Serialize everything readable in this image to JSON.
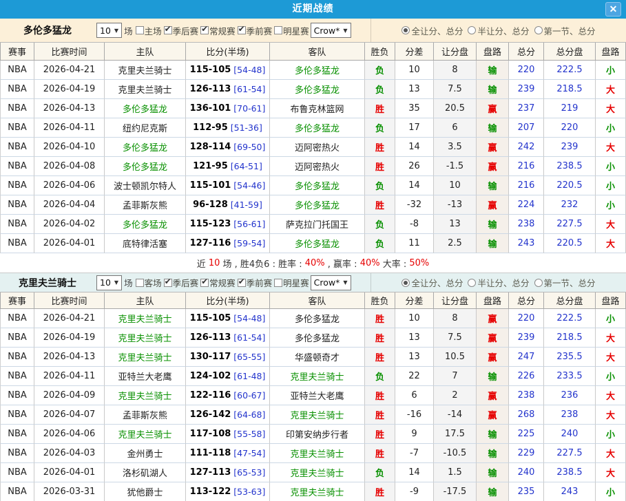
{
  "header": {
    "title": "近期战绩",
    "close_label": "✕"
  },
  "colors": {
    "header_blue": "#1d9ad6",
    "close_btn_blue": "#4da6e2",
    "filter1_bg": "#fcf0d9",
    "filter2_bg": "#e4f1f1",
    "win_red": "#e60000",
    "lose_green": "#089000",
    "number_blue": "#2233cc",
    "team_green": "#089000"
  },
  "sections": [
    {
      "filter": {
        "team": "多伦多猛龙",
        "count_value": "10",
        "count_suffix": "场",
        "checkboxes": [
          {
            "label": "主场",
            "checked": false
          },
          {
            "label": "季后赛",
            "checked": true
          },
          {
            "label": "常规赛",
            "checked": true
          },
          {
            "label": "季前赛",
            "checked": true
          },
          {
            "label": "明星赛",
            "checked": false
          }
        ],
        "team_select_value": "Crow*",
        "radios": [
          {
            "label": "全让分、总分",
            "selected": true
          },
          {
            "label": "半让分、总分",
            "selected": false
          },
          {
            "label": "第一节、总分",
            "selected": false
          }
        ]
      },
      "columns": [
        "赛事",
        "比赛时间",
        "主队",
        "比分(半场)",
        "客队",
        "胜负",
        "分差",
        "让分盘",
        "盘路",
        "总分",
        "总分盘",
        "盘路"
      ],
      "rows": [
        {
          "league": "NBA",
          "date": "2026-04-21",
          "home": "克里夫兰骑士",
          "home_focus": false,
          "score": "115-105",
          "half": "[54-48]",
          "away": "多伦多猛龙",
          "away_focus": true,
          "result": "负",
          "diff": "10",
          "handicap": "8",
          "handicap_result": "输",
          "total": "220",
          "total_line": "222.5",
          "total_result": "小"
        },
        {
          "league": "NBA",
          "date": "2026-04-19",
          "home": "克里夫兰骑士",
          "home_focus": false,
          "score": "126-113",
          "half": "[61-54]",
          "away": "多伦多猛龙",
          "away_focus": true,
          "result": "负",
          "diff": "13",
          "handicap": "7.5",
          "handicap_result": "输",
          "total": "239",
          "total_line": "218.5",
          "total_result": "大"
        },
        {
          "league": "NBA",
          "date": "2026-04-13",
          "home": "多伦多猛龙",
          "home_focus": true,
          "score": "136-101",
          "half": "[70-61]",
          "away": "布鲁克林篮网",
          "away_focus": false,
          "result": "胜",
          "diff": "35",
          "handicap": "20.5",
          "handicap_result": "赢",
          "total": "237",
          "total_line": "219",
          "total_result": "大"
        },
        {
          "league": "NBA",
          "date": "2026-04-11",
          "home": "纽约尼克斯",
          "home_focus": false,
          "score": "112-95",
          "half": "[51-36]",
          "away": "多伦多猛龙",
          "away_focus": true,
          "result": "负",
          "diff": "17",
          "handicap": "6",
          "handicap_result": "输",
          "total": "207",
          "total_line": "220",
          "total_result": "小"
        },
        {
          "league": "NBA",
          "date": "2026-04-10",
          "home": "多伦多猛龙",
          "home_focus": true,
          "score": "128-114",
          "half": "[69-50]",
          "away": "迈阿密热火",
          "away_focus": false,
          "result": "胜",
          "diff": "14",
          "handicap": "3.5",
          "handicap_result": "赢",
          "total": "242",
          "total_line": "239",
          "total_result": "大"
        },
        {
          "league": "NBA",
          "date": "2026-04-08",
          "home": "多伦多猛龙",
          "home_focus": true,
          "score": "121-95",
          "half": "[64-51]",
          "away": "迈阿密热火",
          "away_focus": false,
          "result": "胜",
          "diff": "26",
          "handicap": "-1.5",
          "handicap_result": "赢",
          "total": "216",
          "total_line": "238.5",
          "total_result": "小"
        },
        {
          "league": "NBA",
          "date": "2026-04-06",
          "home": "波士顿凯尔特人",
          "home_focus": false,
          "score": "115-101",
          "half": "[54-46]",
          "away": "多伦多猛龙",
          "away_focus": true,
          "result": "负",
          "diff": "14",
          "handicap": "10",
          "handicap_result": "输",
          "total": "216",
          "total_line": "220.5",
          "total_result": "小"
        },
        {
          "league": "NBA",
          "date": "2026-04-04",
          "home": "孟菲斯灰熊",
          "home_focus": false,
          "score": "96-128",
          "half": "[41-59]",
          "away": "多伦多猛龙",
          "away_focus": true,
          "result": "胜",
          "diff": "-32",
          "handicap": "-13",
          "handicap_result": "赢",
          "total": "224",
          "total_line": "232",
          "total_result": "小"
        },
        {
          "league": "NBA",
          "date": "2026-04-02",
          "home": "多伦多猛龙",
          "home_focus": true,
          "score": "115-123",
          "half": "[56-61]",
          "away": "萨克拉门托国王",
          "away_focus": false,
          "result": "负",
          "diff": "-8",
          "handicap": "13",
          "handicap_result": "输",
          "total": "238",
          "total_line": "227.5",
          "total_result": "大"
        },
        {
          "league": "NBA",
          "date": "2026-04-01",
          "home": "底特律活塞",
          "home_focus": false,
          "score": "127-116",
          "half": "[59-54]",
          "away": "多伦多猛龙",
          "away_focus": true,
          "result": "负",
          "diff": "11",
          "handicap": "2.5",
          "handicap_result": "输",
          "total": "243",
          "total_line": "220.5",
          "total_result": "大"
        }
      ],
      "summary_segments": [
        {
          "text": "近 ",
          "red": false
        },
        {
          "text": "10",
          "red": true
        },
        {
          "text": " 场 , 胜4负6 : 胜率 : ",
          "red": false
        },
        {
          "text": "40%",
          "red": true
        },
        {
          "text": " , 赢率 : ",
          "red": false
        },
        {
          "text": "40%",
          "red": true
        },
        {
          "text": " 大率 : ",
          "red": false
        },
        {
          "text": "50%",
          "red": true
        }
      ]
    },
    {
      "filter": {
        "team": "克里夫兰骑士",
        "count_value": "10",
        "count_suffix": "场",
        "checkboxes": [
          {
            "label": "客场",
            "checked": false
          },
          {
            "label": "季后赛",
            "checked": true
          },
          {
            "label": "常规赛",
            "checked": true
          },
          {
            "label": "季前赛",
            "checked": true
          },
          {
            "label": "明星赛",
            "checked": false
          }
        ],
        "team_select_value": "Crow*",
        "radios": [
          {
            "label": "全让分、总分",
            "selected": true
          },
          {
            "label": "半让分、总分",
            "selected": false
          },
          {
            "label": "第一节、总分",
            "selected": false
          }
        ]
      },
      "columns": [
        "赛事",
        "比赛时间",
        "主队",
        "比分(半场)",
        "客队",
        "胜负",
        "分差",
        "让分盘",
        "盘路",
        "总分",
        "总分盘",
        "盘路"
      ],
      "rows": [
        {
          "league": "NBA",
          "date": "2026-04-21",
          "home": "克里夫兰骑士",
          "home_focus": true,
          "score": "115-105",
          "half": "[54-48]",
          "away": "多伦多猛龙",
          "away_focus": false,
          "result": "胜",
          "diff": "10",
          "handicap": "8",
          "handicap_result": "赢",
          "total": "220",
          "total_line": "222.5",
          "total_result": "小"
        },
        {
          "league": "NBA",
          "date": "2026-04-19",
          "home": "克里夫兰骑士",
          "home_focus": true,
          "score": "126-113",
          "half": "[61-54]",
          "away": "多伦多猛龙",
          "away_focus": false,
          "result": "胜",
          "diff": "13",
          "handicap": "7.5",
          "handicap_result": "赢",
          "total": "239",
          "total_line": "218.5",
          "total_result": "大"
        },
        {
          "league": "NBA",
          "date": "2026-04-13",
          "home": "克里夫兰骑士",
          "home_focus": true,
          "score": "130-117",
          "half": "[65-55]",
          "away": "华盛顿奇才",
          "away_focus": false,
          "result": "胜",
          "diff": "13",
          "handicap": "10.5",
          "handicap_result": "赢",
          "total": "247",
          "total_line": "235.5",
          "total_result": "大"
        },
        {
          "league": "NBA",
          "date": "2026-04-11",
          "home": "亚特兰大老鹰",
          "home_focus": false,
          "score": "124-102",
          "half": "[61-48]",
          "away": "克里夫兰骑士",
          "away_focus": true,
          "result": "负",
          "diff": "22",
          "handicap": "7",
          "handicap_result": "输",
          "total": "226",
          "total_line": "233.5",
          "total_result": "小"
        },
        {
          "league": "NBA",
          "date": "2026-04-09",
          "home": "克里夫兰骑士",
          "home_focus": true,
          "score": "122-116",
          "half": "[60-67]",
          "away": "亚特兰大老鹰",
          "away_focus": false,
          "result": "胜",
          "diff": "6",
          "handicap": "2",
          "handicap_result": "赢",
          "total": "238",
          "total_line": "236",
          "total_result": "大"
        },
        {
          "league": "NBA",
          "date": "2026-04-07",
          "home": "孟菲斯灰熊",
          "home_focus": false,
          "score": "126-142",
          "half": "[64-68]",
          "away": "克里夫兰骑士",
          "away_focus": true,
          "result": "胜",
          "diff": "-16",
          "handicap": "-14",
          "handicap_result": "赢",
          "total": "268",
          "total_line": "238",
          "total_result": "大"
        },
        {
          "league": "NBA",
          "date": "2026-04-06",
          "home": "克里夫兰骑士",
          "home_focus": true,
          "score": "117-108",
          "half": "[55-58]",
          "away": "印第安纳步行者",
          "away_focus": false,
          "result": "胜",
          "diff": "9",
          "handicap": "17.5",
          "handicap_result": "输",
          "total": "225",
          "total_line": "240",
          "total_result": "小"
        },
        {
          "league": "NBA",
          "date": "2026-04-03",
          "home": "金州勇士",
          "home_focus": false,
          "score": "111-118",
          "half": "[47-54]",
          "away": "克里夫兰骑士",
          "away_focus": true,
          "result": "胜",
          "diff": "-7",
          "handicap": "-10.5",
          "handicap_result": "输",
          "total": "229",
          "total_line": "227.5",
          "total_result": "大"
        },
        {
          "league": "NBA",
          "date": "2026-04-01",
          "home": "洛杉矶湖人",
          "home_focus": false,
          "score": "127-113",
          "half": "[65-53]",
          "away": "克里夫兰骑士",
          "away_focus": true,
          "result": "负",
          "diff": "14",
          "handicap": "1.5",
          "handicap_result": "输",
          "total": "240",
          "total_line": "238.5",
          "total_result": "大"
        },
        {
          "league": "NBA",
          "date": "2026-03-31",
          "home": "犹他爵士",
          "home_focus": false,
          "score": "113-122",
          "half": "[53-63]",
          "away": "克里夫兰骑士",
          "away_focus": true,
          "result": "胜",
          "diff": "-9",
          "handicap": "-17.5",
          "handicap_result": "输",
          "total": "235",
          "total_line": "243",
          "total_result": "小"
        }
      ],
      "summary_segments": null
    }
  ]
}
